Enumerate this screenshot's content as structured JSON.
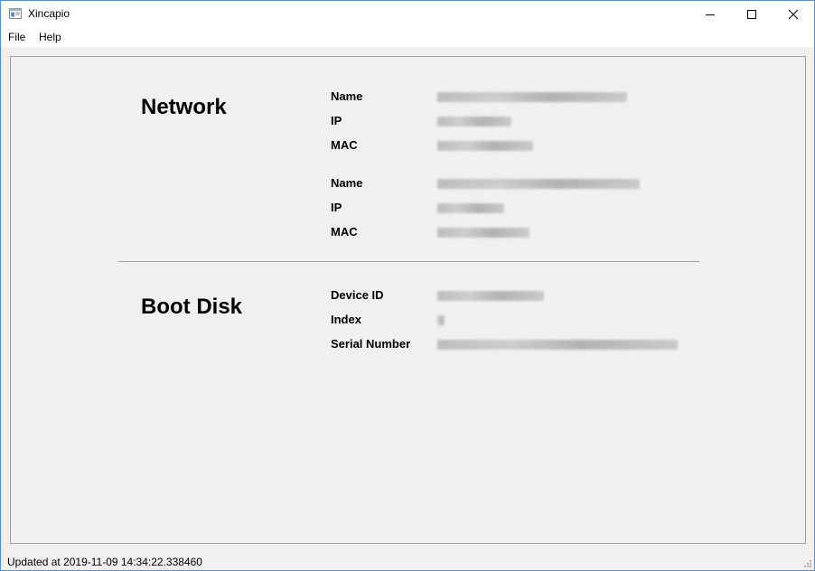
{
  "window": {
    "title": "Xincapio",
    "app_icon": "window-app-icon",
    "controls": {
      "minimize": "minimize-icon",
      "maximize": "maximize-icon",
      "close": "close-icon"
    }
  },
  "menu": {
    "file_label": "File",
    "help_label": "Help"
  },
  "network": {
    "title": "Network",
    "adapters": [
      {
        "name_label": "Name",
        "name_value": "",
        "ip_label": "IP",
        "ip_value": "",
        "mac_label": "MAC",
        "mac_value": ""
      },
      {
        "name_label": "Name",
        "name_value": "",
        "ip_label": "IP",
        "ip_value": "",
        "mac_label": "MAC",
        "mac_value": ""
      }
    ]
  },
  "boot_disk": {
    "title": "Boot Disk",
    "device_id_label": "Device ID",
    "device_id_value": "",
    "index_label": "Index",
    "index_value": "",
    "serial_label": "Serial Number",
    "serial_value": ""
  },
  "status": {
    "text": "Updated at 2019-11-09 14:34:22.338460"
  }
}
